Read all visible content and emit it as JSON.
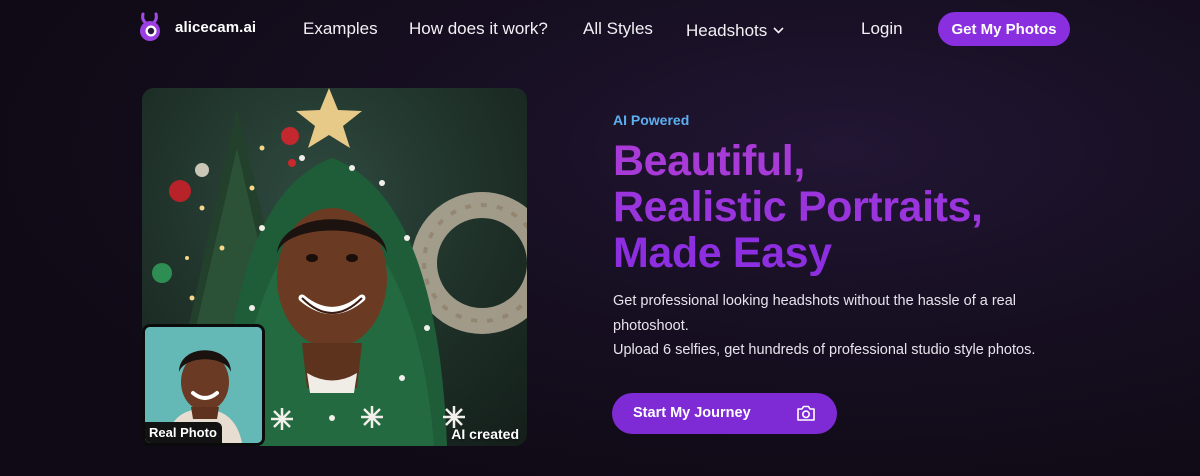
{
  "brand": {
    "name": "alicecam.ai",
    "logo_icon": "bunny-camera-logo-icon"
  },
  "nav": {
    "links": [
      "Examples",
      "How does it work?",
      "All Styles",
      "Headshots"
    ],
    "login": "Login",
    "cta": "Get My Photos"
  },
  "hero": {
    "eyebrow": "AI Powered",
    "headline": [
      "Beautiful,",
      "Realistic Portraits,",
      "Made Easy"
    ],
    "description": [
      "Get professional looking headshots without the hassle of a real",
      "photoshoot.",
      "Upload 6 selfies, get hundreds of professional studio style photos."
    ],
    "cta": "Start My Journey",
    "cta_icon": "camera-icon",
    "image_caption": "AI created",
    "inset_caption": "Real Photo"
  },
  "colors": {
    "accent": "#8a2fe0",
    "eyebrow": "#5cb0f0",
    "background": "#170f22"
  }
}
